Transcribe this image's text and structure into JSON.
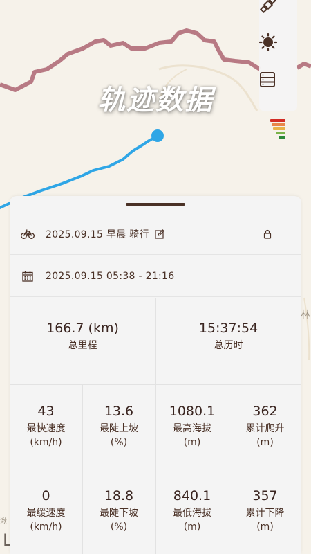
{
  "colors": {
    "track": "#2fa6e6",
    "boundary": "#b87a84",
    "accent_brown": "#4a3126"
  },
  "map": {
    "title": "轨迹数据",
    "edge_label": "林",
    "edge_label_left": "湫",
    "edge_glyph": "L"
  },
  "toolbar": {
    "items": [
      {
        "icon": "satellite-icon"
      },
      {
        "icon": "brightness-icon"
      },
      {
        "icon": "layers-list-icon"
      }
    ]
  },
  "signal_bars": [
    "#d22c24",
    "#e8864a",
    "#e9b24a",
    "#7ab34a",
    "#2d8a3a"
  ],
  "header": {
    "activity_title": "2025.09.15 早晨 骑行",
    "time_range": "2025.09.15 05:38 - 21:16"
  },
  "summary": [
    {
      "value": "166.7 (km)",
      "label": "总里程"
    },
    {
      "value": "15:37:54",
      "label": "总历时"
    }
  ],
  "stats": [
    {
      "value": "43",
      "label": "最快速度",
      "unit": "(km/h)"
    },
    {
      "value": "13.6",
      "label": "最陡上坡",
      "unit": "(%)"
    },
    {
      "value": "1080.1",
      "label": "最高海拔",
      "unit": "(m)"
    },
    {
      "value": "362",
      "label": "累计爬升",
      "unit": "(m)"
    },
    {
      "value": "0",
      "label": "最缓速度",
      "unit": "(km/h)"
    },
    {
      "value": "18.8",
      "label": "最陡下坡",
      "unit": "(%)"
    },
    {
      "value": "840.1",
      "label": "最低海拔",
      "unit": "(m)"
    },
    {
      "value": "357",
      "label": "累计下降",
      "unit": "(m)"
    }
  ]
}
